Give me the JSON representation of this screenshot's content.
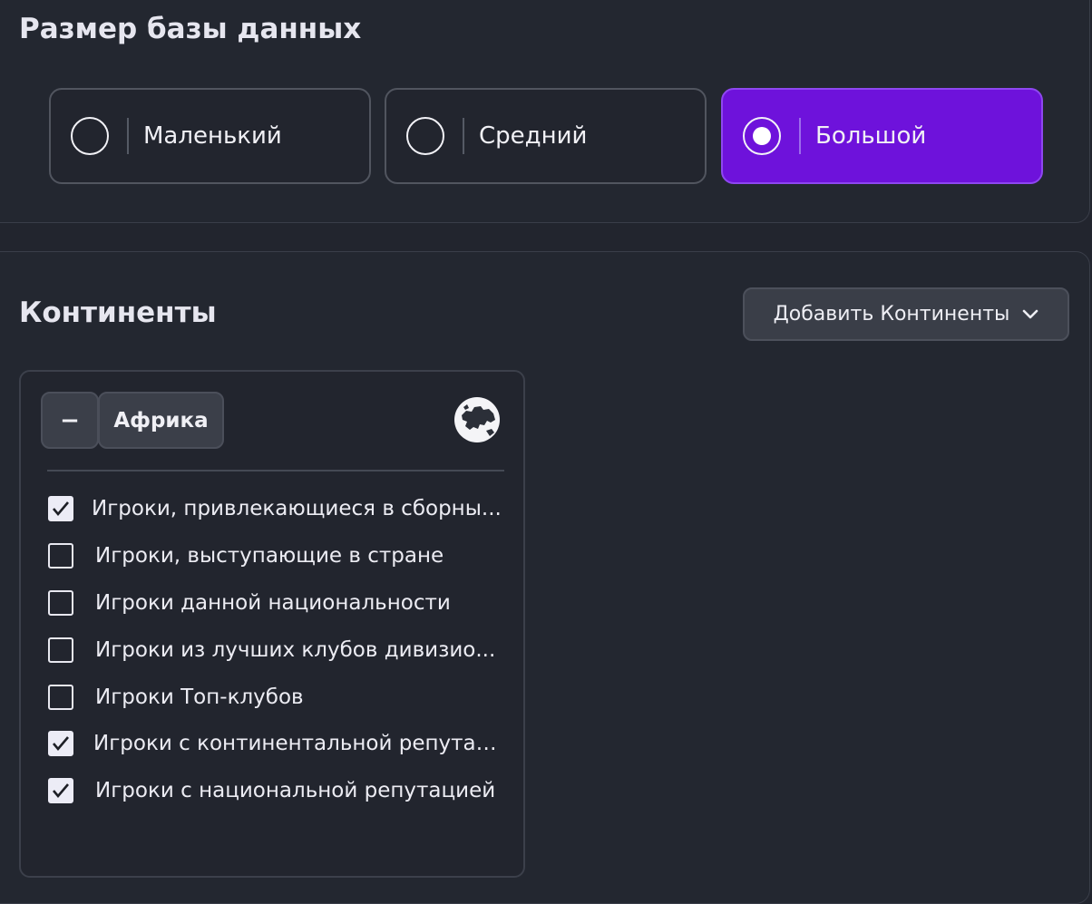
{
  "database_size": {
    "title": "Размер базы данных",
    "options": [
      {
        "label": "Маленький",
        "selected": false
      },
      {
        "label": "Средний",
        "selected": false
      },
      {
        "label": "Большой",
        "selected": true
      }
    ],
    "accent_color": "#6e12db"
  },
  "continents": {
    "title": "Континенты",
    "add_button_label": "Добавить Континенты",
    "items": [
      {
        "name": "Африка",
        "remove_label": "−",
        "icon": "globe-europe-icon",
        "checkboxes": [
          {
            "label": "Игроки, привлекающиеся в сборны...",
            "checked": true
          },
          {
            "label": "Игроки, выступающие в стране",
            "checked": false
          },
          {
            "label": "Игроки данной национальности",
            "checked": false
          },
          {
            "label": "Игроки из лучших клубов дивизио...",
            "checked": false
          },
          {
            "label": "Игроки Топ-клубов",
            "checked": false
          },
          {
            "label": "Игроки с континентальной репутац...",
            "checked": true
          },
          {
            "label": "Игроки с национальной репутацией",
            "checked": true
          }
        ]
      }
    ]
  }
}
